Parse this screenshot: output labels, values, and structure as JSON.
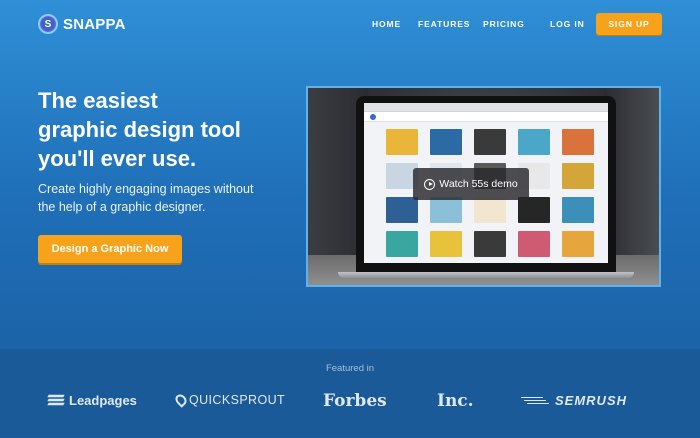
{
  "brand": {
    "logo_letter": "S",
    "name": "SNAPPA"
  },
  "nav": {
    "home": "HOME",
    "features": "FEATURES",
    "pricing": "PRICING",
    "login": "LOG IN",
    "signup": "SIGN UP"
  },
  "hero": {
    "headline_1": "The easiest",
    "headline_2": "graphic design tool",
    "headline_3": "you'll ever use.",
    "subline_1": "Create highly engaging images without",
    "subline_2": "the help of a graphic designer.",
    "cta": "Design a Graphic Now"
  },
  "video": {
    "watch_label": "Watch 55s demo"
  },
  "featured": {
    "title": "Featured in",
    "leadpages": "Leadpages",
    "quicksprout": "QUICKSPROUT",
    "forbes": "Forbes",
    "inc": "Inc.",
    "semrush": "SEMRUSH"
  },
  "colors": {
    "accent": "#f6a31b",
    "bg_top": "#2f8fd6",
    "bg_bottom": "#1a5c9f"
  }
}
